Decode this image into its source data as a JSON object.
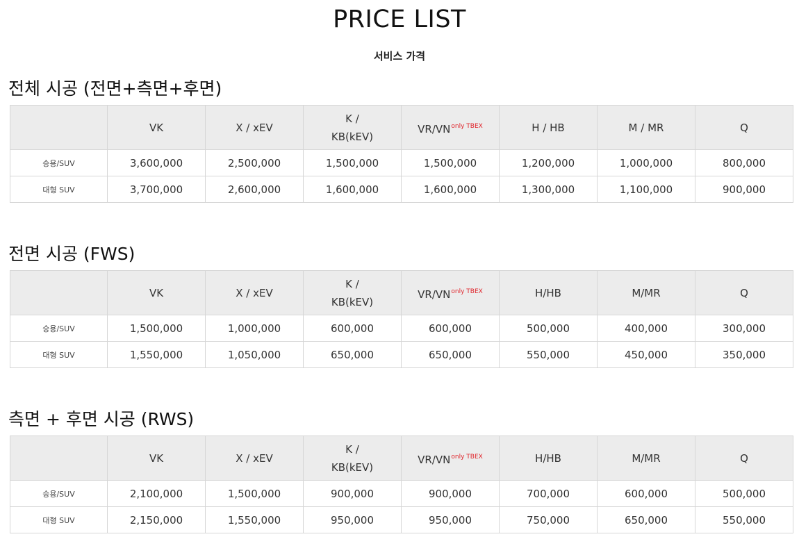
{
  "page": {
    "title": "PRICE LIST",
    "subtitle": "서비스 가격"
  },
  "sections": [
    {
      "title": "전체 시공 (전면+측면+후면)",
      "headers": {
        "vk": "VK",
        "x": "X / xEV",
        "k_line1": "K /",
        "k_line2": "KB(kEV)",
        "vr": "VR/VN",
        "vr_note": "only TBEX",
        "h": "H / HB",
        "m": "M / MR",
        "q": "Q"
      },
      "rows": [
        {
          "label": "승용/SUV",
          "values": [
            "3,600,000",
            "2,500,000",
            "1,500,000",
            "1,500,000",
            "1,200,000",
            "1,000,000",
            "800,000"
          ]
        },
        {
          "label": "대형 SUV",
          "values": [
            "3,700,000",
            "2,600,000",
            "1,600,000",
            "1,600,000",
            "1,300,000",
            "1,100,000",
            "900,000"
          ]
        }
      ]
    },
    {
      "title": "전면 시공 (FWS)",
      "headers": {
        "vk": "VK",
        "x": "X / xEV",
        "k_line1": "K /",
        "k_line2": "KB(kEV)",
        "vr": "VR/VN",
        "vr_note": "only TBEX",
        "h": "H/HB",
        "m": "M/MR",
        "q": "Q"
      },
      "rows": [
        {
          "label": "승용/SUV",
          "values": [
            "1,500,000",
            "1,000,000",
            "600,000",
            "600,000",
            "500,000",
            "400,000",
            "300,000"
          ]
        },
        {
          "label": "대형 SUV",
          "values": [
            "1,550,000",
            "1,050,000",
            "650,000",
            "650,000",
            "550,000",
            "450,000",
            "350,000"
          ]
        }
      ]
    },
    {
      "title": "측면 + 후면 시공 (RWS)",
      "headers": {
        "vk": "VK",
        "x": "X / xEV",
        "k_line1": "K /",
        "k_line2": "KB(kEV)",
        "vr": "VR/VN",
        "vr_note": "only TBEX",
        "h": "H/HB",
        "m": "M/MR",
        "q": "Q"
      },
      "rows": [
        {
          "label": "승용/SUV",
          "values": [
            "2,100,000",
            "1,500,000",
            "900,000",
            "900,000",
            "700,000",
            "600,000",
            "500,000"
          ]
        },
        {
          "label": "대형 SUV",
          "values": [
            "2,150,000",
            "1,550,000",
            "950,000",
            "950,000",
            "750,000",
            "650,000",
            "550,000"
          ]
        }
      ]
    }
  ]
}
